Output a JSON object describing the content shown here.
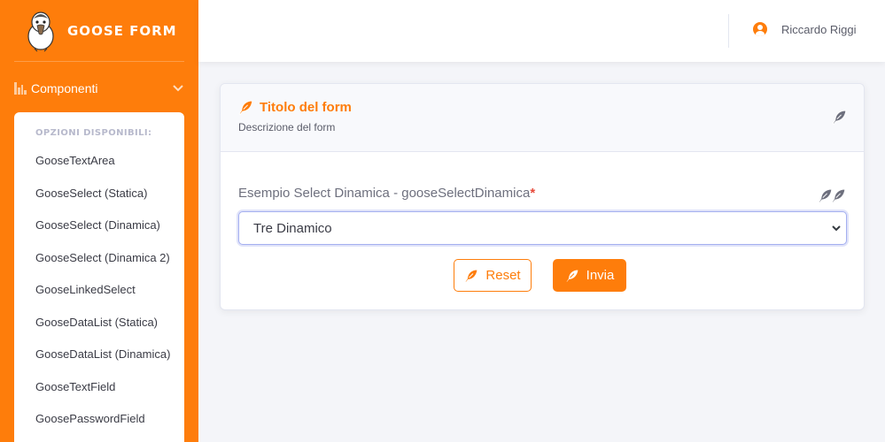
{
  "brand": {
    "name": "GOOSE FORM",
    "logo": "goose-logo"
  },
  "sidebar": {
    "nav": {
      "label": "Componenti",
      "icon": "chart-icon",
      "chevron": "chevron-down-icon"
    },
    "submenu": {
      "header": "OPZIONI DISPONIBILI:",
      "items": [
        {
          "label": "GooseTextArea"
        },
        {
          "label": "GooseSelect (Statica)"
        },
        {
          "label": "GooseSelect (Dinamica)"
        },
        {
          "label": "GooseSelect (Dinamica 2)"
        },
        {
          "label": "GooseLinkedSelect"
        },
        {
          "label": "GooseDataList (Statica)"
        },
        {
          "label": "GooseDataList (Dinamica)"
        },
        {
          "label": "GooseTextField"
        },
        {
          "label": "GoosePasswordField"
        }
      ]
    }
  },
  "topbar": {
    "user_name": "Riccardo Riggi",
    "user_icon": "user-circle-icon"
  },
  "card": {
    "title": "Titolo del form",
    "description": "Descrizione del form",
    "field_label": "Esempio Select Dinamica - gooseSelectDinamica",
    "required_mark": "*",
    "select_value": "Tre Dinamico",
    "reset_label": "Reset",
    "submit_label": "Invia"
  },
  "colors": {
    "accent": "#fe7d0b",
    "required": "#e74a3b",
    "icon_gray": "#6e707e"
  }
}
